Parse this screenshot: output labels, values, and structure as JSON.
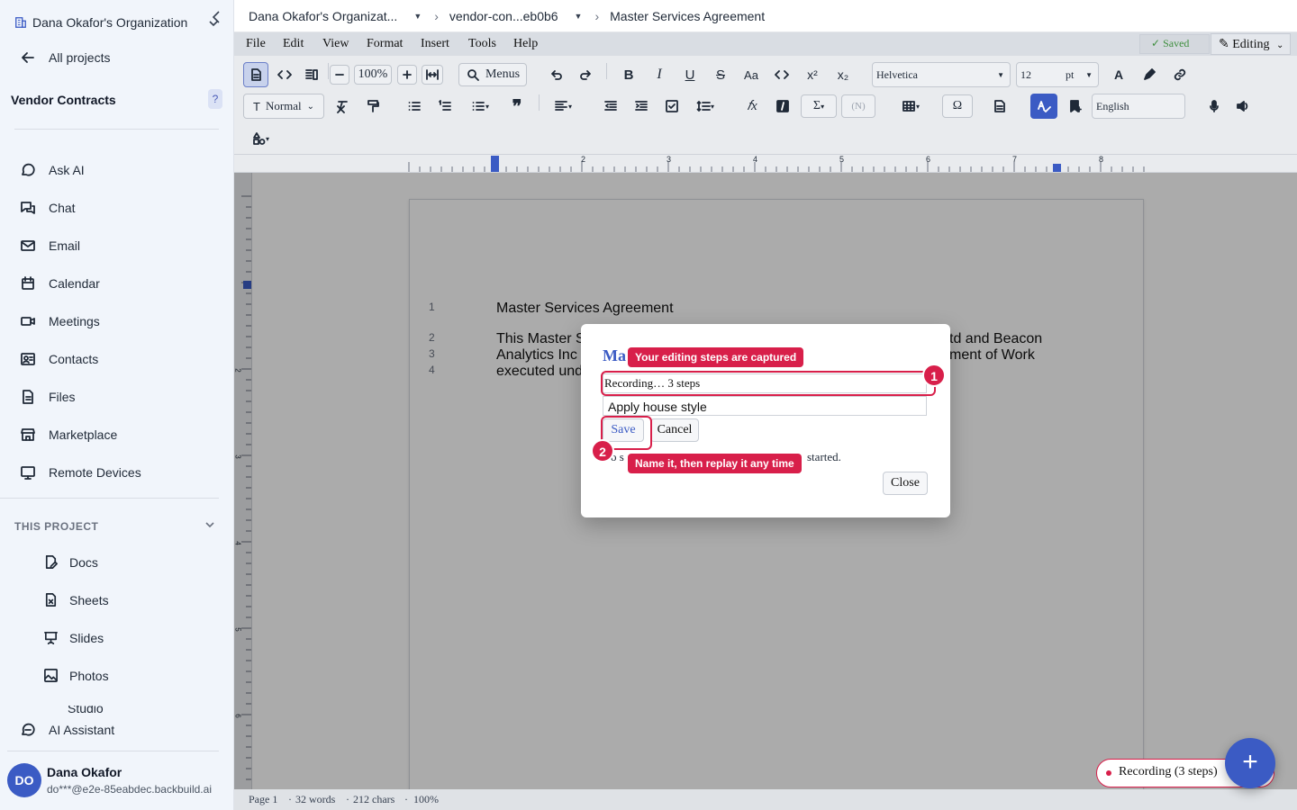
{
  "sidebar": {
    "org_name": "Dana Okafor's Organization",
    "all_projects": "All projects",
    "project_name": "Vendor Contracts",
    "help_badge": "?",
    "nav": [
      "Ask AI",
      "Chat",
      "Email",
      "Calendar",
      "Meetings",
      "Contacts",
      "Files",
      "Marketplace",
      "Remote Devices"
    ],
    "section_label": "THIS PROJECT",
    "project_items": [
      "Docs",
      "Sheets",
      "Slides",
      "Photos",
      "Studio"
    ],
    "ai_assistant": "AI Assistant",
    "user": {
      "initials": "DO",
      "name": "Dana Okafor",
      "email": "do***@e2e-85eabdec.backbuild.ai"
    }
  },
  "breadcrumb": {
    "org": "Dana Okafor's Organizat...",
    "folder": "vendor-con...eb0b6",
    "document": "Master Services Agreement"
  },
  "menubar": {
    "items": [
      "File",
      "Edit",
      "View",
      "Format",
      "Insert",
      "Tools",
      "Help"
    ],
    "saved": "Saved",
    "mode": "Editing"
  },
  "toolbar": {
    "zoom": "100%",
    "menus": "Menus",
    "font": "Helvetica",
    "font_size": "12",
    "unit": "pt",
    "style": "Normal",
    "language": "English"
  },
  "ruler_numbers": [
    "2",
    "3",
    "4",
    "5",
    "6",
    "7",
    "8"
  ],
  "vruler_numbers": [
    "1",
    "2",
    "3",
    "4",
    "5",
    "6"
  ],
  "document": {
    "line_numbers": [
      "1",
      "2",
      "3",
      "4"
    ],
    "title": "Master Services Agreement",
    "lines": [
      "This Master S",
      "Analytics Inc",
      "executed und"
    ],
    "lines_right": [
      "td and Beacon",
      "ment of Work"
    ]
  },
  "modal": {
    "title": "Ma",
    "recording_text": "Recording… 3 steps",
    "name_value": "Apply house style",
    "save": "Save",
    "cancel": "Cancel",
    "hint_start": "o s",
    "hint_end": "started.",
    "close": "Close"
  },
  "tour": {
    "step1_num": "1",
    "step1_label": "Your editing steps are captured",
    "step2_num": "2",
    "step2_label": "Name it, then replay it any time"
  },
  "status": {
    "page": "Page 1",
    "words": "32 words",
    "chars": "212 chars",
    "zoom": "100%"
  },
  "recording_pill": "Recording (3 steps)",
  "fab_icon": "+",
  "colors": {
    "accent": "#3b5bc4",
    "tour": "#d81f4a",
    "saved": "#3f8f3f"
  }
}
